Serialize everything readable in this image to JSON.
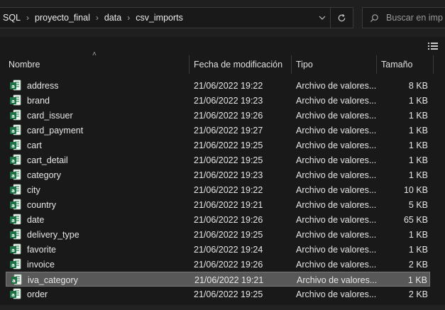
{
  "breadcrumb": [
    "SQL",
    "proyecto_final",
    "data",
    "csv_imports"
  ],
  "search": {
    "placeholder": "Buscar en imp"
  },
  "columns": {
    "name": "Nombre",
    "date": "Fecha de modificación",
    "type": "Tipo",
    "size": "Tamaño"
  },
  "files": [
    {
      "name": "address",
      "date": "21/06/2022 19:22",
      "type": "Archivo de valores...",
      "size": "8 KB"
    },
    {
      "name": "brand",
      "date": "21/06/2022 19:23",
      "type": "Archivo de valores...",
      "size": "1 KB"
    },
    {
      "name": "card_issuer",
      "date": "21/06/2022 19:26",
      "type": "Archivo de valores...",
      "size": "1 KB"
    },
    {
      "name": "card_payment",
      "date": "21/06/2022 19:27",
      "type": "Archivo de valores...",
      "size": "1 KB"
    },
    {
      "name": "cart",
      "date": "21/06/2022 19:25",
      "type": "Archivo de valores...",
      "size": "1 KB"
    },
    {
      "name": "cart_detail",
      "date": "21/06/2022 19:25",
      "type": "Archivo de valores...",
      "size": "1 KB"
    },
    {
      "name": "category",
      "date": "21/06/2022 19:23",
      "type": "Archivo de valores...",
      "size": "1 KB"
    },
    {
      "name": "city",
      "date": "21/06/2022 19:22",
      "type": "Archivo de valores...",
      "size": "10 KB"
    },
    {
      "name": "country",
      "date": "21/06/2022 19:21",
      "type": "Archivo de valores...",
      "size": "5 KB"
    },
    {
      "name": "date",
      "date": "21/06/2022 19:26",
      "type": "Archivo de valores...",
      "size": "65 KB"
    },
    {
      "name": "delivery_type",
      "date": "21/06/2022 19:25",
      "type": "Archivo de valores...",
      "size": "1 KB"
    },
    {
      "name": "favorite",
      "date": "21/06/2022 19:24",
      "type": "Archivo de valores...",
      "size": "1 KB"
    },
    {
      "name": "invoice",
      "date": "21/06/2022 19:26",
      "type": "Archivo de valores...",
      "size": "2 KB"
    },
    {
      "name": "iva_category",
      "date": "21/06/2022 19:21",
      "type": "Archivo de valores...",
      "size": "1 KB",
      "selected": true
    },
    {
      "name": "order",
      "date": "21/06/2022 19:25",
      "type": "Archivo de valores...",
      "size": "2 KB"
    }
  ],
  "colors": {
    "background": "#191919",
    "selected_row": "#585858",
    "icon_green": "#1e7145"
  },
  "icons": {
    "file": "csv-excel-file-icon",
    "refresh": "refresh-icon",
    "search": "search-icon",
    "dropdown": "chevron-down-icon",
    "view": "details-view-icon",
    "breadcrumb_separator": "chevron-right-icon"
  }
}
